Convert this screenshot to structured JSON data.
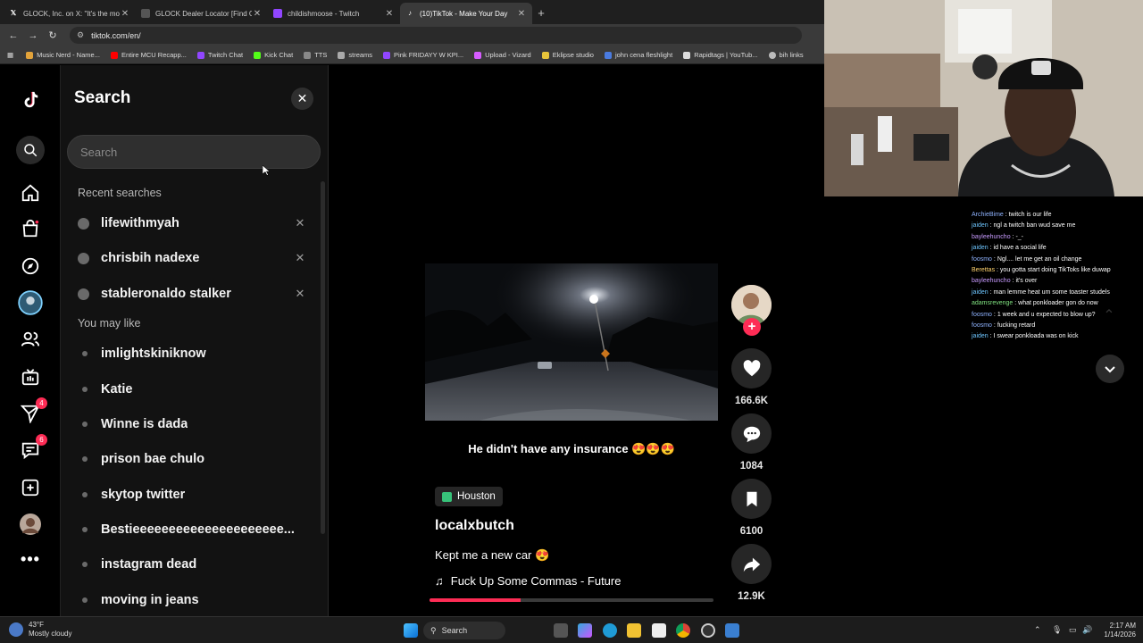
{
  "browser": {
    "tabs": [
      {
        "title": "GLOCK, Inc. on X: \"It's the most",
        "icon": "x-logo-icon",
        "active": false
      },
      {
        "title": "GLOCK Dealer Locator [Find Gu",
        "icon": "glock-icon",
        "active": false
      },
      {
        "title": "childishmoose - Twitch",
        "icon": "twitch-icon",
        "active": false
      },
      {
        "title": "(10)TikTok - Make Your Day",
        "icon": "tiktok-icon",
        "active": true
      }
    ],
    "url": "tiktok.com/en/",
    "bookmarks": [
      "Music Nerd - Name...",
      "Entire MCU Recapp...",
      "Twitch Chat",
      "Kick Chat",
      "TTS",
      "streams",
      "Pink FRIDAYY W KPI...",
      "Upload - Vizard",
      "Eklipse studio",
      "john cena fleshlight",
      "Rapidtags | YouTub...",
      "bih links"
    ]
  },
  "search_panel": {
    "title": "Search",
    "placeholder": "Search",
    "recent_heading": "Recent searches",
    "recent": [
      "lifewithmyah",
      "chrisbih nadexe",
      "stableronaldo stalker"
    ],
    "like_heading": "You may like",
    "suggestions": [
      "imlightskiniknow",
      "Katie",
      "Winne is dada",
      "prison bae chulo",
      "skytop twitter",
      "Bestieeeeeeeeeeeeeeeeeeeee...",
      "instagram dead",
      "moving in jeans"
    ]
  },
  "rail": {
    "badges": {
      "messages": "4",
      "inbox": "6"
    }
  },
  "video": {
    "caption": "He didn't have any insurance 😍😍😍",
    "location": "Houston",
    "username": "localxbutch",
    "description": "Kept me a new car 😍",
    "music": "Fuck Up Some Commas - Future",
    "progress": 0.32,
    "likes": "166.6K",
    "comments": "1084",
    "saves": "6100",
    "shares": "12.9K"
  },
  "chat": [
    {
      "user": "ArchieBime",
      "color": "#8fb3ff",
      "text": "twitch is our life"
    },
    {
      "user": "jaiden",
      "color": "#6ec6ff",
      "text": "ngl a twitch ban wud save me"
    },
    {
      "user": "bayleehuncho",
      "color": "#c89bff",
      "text": "-_-"
    },
    {
      "user": "jaiden",
      "color": "#6ec6ff",
      "text": "id have a social life"
    },
    {
      "user": "foosmo",
      "color": "#8fb3ff",
      "text": "Ngl.... let me get an oil change"
    },
    {
      "user": "Berettas",
      "color": "#ffd36e",
      "text": "you gotta start doing TikToks like duwap"
    },
    {
      "user": "bayleehuncho",
      "color": "#c89bff",
      "text": "it's over"
    },
    {
      "user": "jaiden",
      "color": "#6ec6ff",
      "text": "man lemme heat um some toaster studels"
    },
    {
      "user": "adamsrevenge",
      "color": "#7fe07f",
      "text": "what ponkloader gon do now"
    },
    {
      "user": "foosmo",
      "color": "#8fb3ff",
      "text": "1 week and u expected to blow up?"
    },
    {
      "user": "foosmo",
      "color": "#8fb3ff",
      "text": "fucking retard"
    },
    {
      "user": "jaiden",
      "color": "#6ec6ff",
      "text": "I swear ponkloada was on kick"
    }
  ],
  "taskbar": {
    "temp": "43°F",
    "weather": "Mostly cloudy",
    "search": "Search",
    "time": "2:17 AM",
    "date": "1/14/2026"
  },
  "colors": {
    "accent": "#fe2c55",
    "panel": "#121212"
  }
}
